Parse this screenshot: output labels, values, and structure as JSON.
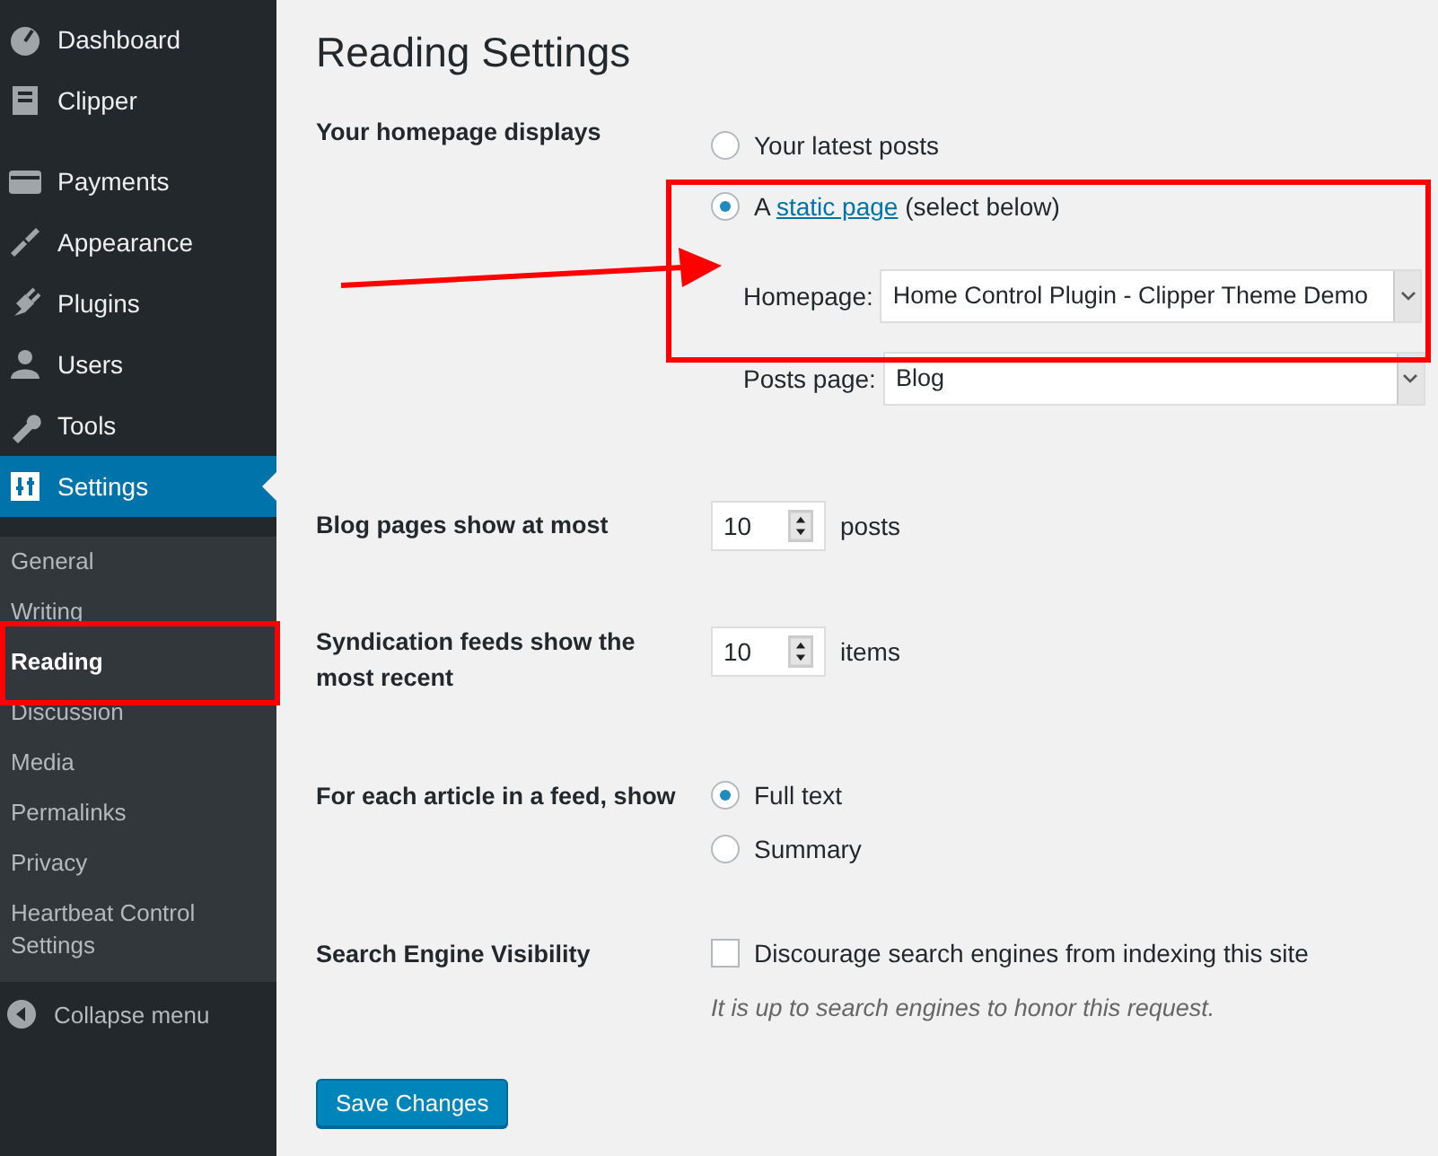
{
  "sidebar": {
    "menu_groups": [
      [
        {
          "label": "Dashboard",
          "selected": false
        },
        {
          "label": "Clipper",
          "selected": false
        }
      ],
      [
        {
          "label": "Payments",
          "selected": false
        },
        {
          "label": "Appearance",
          "selected": false
        },
        {
          "label": "Plugins",
          "selected": false
        },
        {
          "label": "Users",
          "selected": false
        },
        {
          "label": "Tools",
          "selected": false
        },
        {
          "label": "Settings",
          "selected": true
        }
      ]
    ],
    "submenu": [
      {
        "label": "General",
        "selected": false
      },
      {
        "label": "Writing",
        "selected": false
      },
      {
        "label": "Reading",
        "selected": true
      },
      {
        "label": "Discussion",
        "selected": false
      },
      {
        "label": "Media",
        "selected": false
      },
      {
        "label": "Permalinks",
        "selected": false
      },
      {
        "label": "Privacy",
        "selected": false
      },
      {
        "label": "Heartbeat Control Settings",
        "selected": false
      }
    ],
    "collapse_label": "Collapse menu"
  },
  "page": {
    "title": "Reading Settings",
    "rows": [
      {
        "kind": "homepage",
        "label": "Your homepage displays",
        "options": [
          {
            "prefix": "Your latest posts",
            "selected": false
          },
          {
            "prefix": "A",
            "link": "static page",
            "suffix": "(select below)",
            "selected": true
          }
        ],
        "selects": [
          {
            "label": "Homepage:",
            "value": "Home Control Plugin - Clipper Theme Demo"
          },
          {
            "label": "Posts page:",
            "value": "Blog"
          }
        ]
      },
      {
        "kind": "number",
        "label": "Blog pages show at most",
        "value": "10",
        "unit": "posts"
      },
      {
        "kind": "number",
        "label": "Syndication feeds show the most recent",
        "value": "10",
        "unit": "items"
      },
      {
        "kind": "radio",
        "label": "For each article in a feed, show",
        "options": [
          {
            "prefix": "Full text",
            "selected": true
          },
          {
            "prefix": "Summary",
            "selected": false
          }
        ]
      },
      {
        "kind": "checkbox",
        "label": "Search Engine Visibility",
        "option": "Discourage search engines from indexing this site",
        "checked": false,
        "description": "It is up to search engines to honor this request."
      }
    ],
    "save_button": "Save Changes"
  }
}
